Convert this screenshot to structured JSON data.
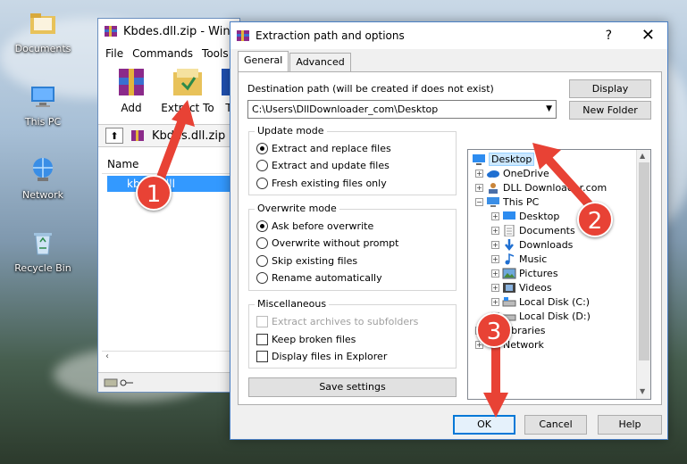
{
  "desktop": {
    "icons": [
      {
        "label": "Documents"
      },
      {
        "label": "This PC"
      },
      {
        "label": "Network"
      },
      {
        "label": "Recycle Bin"
      }
    ]
  },
  "winrar": {
    "title": "Kbdes.dll.zip - WinR",
    "menu": [
      "File",
      "Commands",
      "Tools"
    ],
    "toolbar": {
      "add": "Add",
      "extract_to": "Extract To",
      "partial": "T"
    },
    "address": "Kbdes.dll.zip",
    "column_name": "Name",
    "selected_file": "kbdes.dll"
  },
  "dialog": {
    "title": "Extraction path and options",
    "help_glyph": "?",
    "close_glyph": "✕",
    "tabs": {
      "general": "General",
      "advanced": "Advanced"
    },
    "destination_label": "Destination path (will be created if does not exist)",
    "destination_value": "C:\\Users\\DllDownloader_com\\Desktop",
    "display_button": "Display",
    "new_folder_button": "New Folder",
    "update_mode": {
      "title": "Update mode",
      "options": [
        "Extract and replace files",
        "Extract and update files",
        "Fresh existing files only"
      ]
    },
    "overwrite_mode": {
      "title": "Overwrite mode",
      "options": [
        "Ask before overwrite",
        "Overwrite without prompt",
        "Skip existing files",
        "Rename automatically"
      ]
    },
    "misc": {
      "title": "Miscellaneous",
      "options": [
        "Extract archives to subfolders",
        "Keep broken files",
        "Display files in Explorer"
      ]
    },
    "save_settings": "Save settings",
    "tree": [
      "Desktop",
      "OneDrive",
      "DLL Downloader.com",
      "This PC",
      "Desktop",
      "Documents",
      "Downloads",
      "Music",
      "Pictures",
      "Videos",
      "Local Disk (C:)",
      "Local Disk (D:)",
      "Libraries",
      "Network"
    ],
    "ok": "OK",
    "cancel": "Cancel",
    "help": "Help"
  },
  "callouts": [
    "1",
    "2",
    "3"
  ]
}
